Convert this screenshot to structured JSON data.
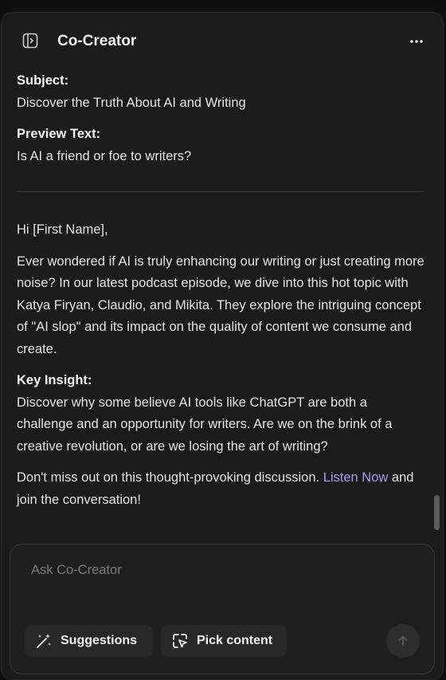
{
  "header": {
    "title": "Co-Creator",
    "toggle_icon": "sidebar-toggle-icon",
    "more_icon": "more-horizontal-icon"
  },
  "email": {
    "subject_label": "Subject:",
    "subject_value": "Discover the Truth About AI and Writing",
    "preview_label": "Preview Text:",
    "preview_value": "Is AI a friend or foe to writers?",
    "greeting": "Hi [First Name],",
    "intro": "Ever wondered if AI is truly enhancing our writing or just creating more noise? In our latest podcast episode, we dive into this hot topic with Katya Firyan, Claudio, and Mikita. They explore the intriguing concept of \"AI slop\" and its impact on the quality of content we consume and create.",
    "insight_label": "Key Insight:",
    "insight_value": "Discover why some believe AI tools like ChatGPT are both a challenge and an opportunity for writers. Are we on the brink of a creative revolution, or are we losing the art of writing?",
    "cta_before": "Don't miss out on this thought-provoking discussion. ",
    "cta_link": "Listen Now",
    "cta_after": " and join the conversation!"
  },
  "composer": {
    "placeholder": "Ask Co-Creator",
    "value": "",
    "suggestions_label": "Suggestions",
    "pick_content_label": "Pick content",
    "send_icon": "arrow-up-icon"
  },
  "colors": {
    "background": "#1b1b1b",
    "link": "#a79bf2",
    "composer_border": "#3b3650"
  }
}
